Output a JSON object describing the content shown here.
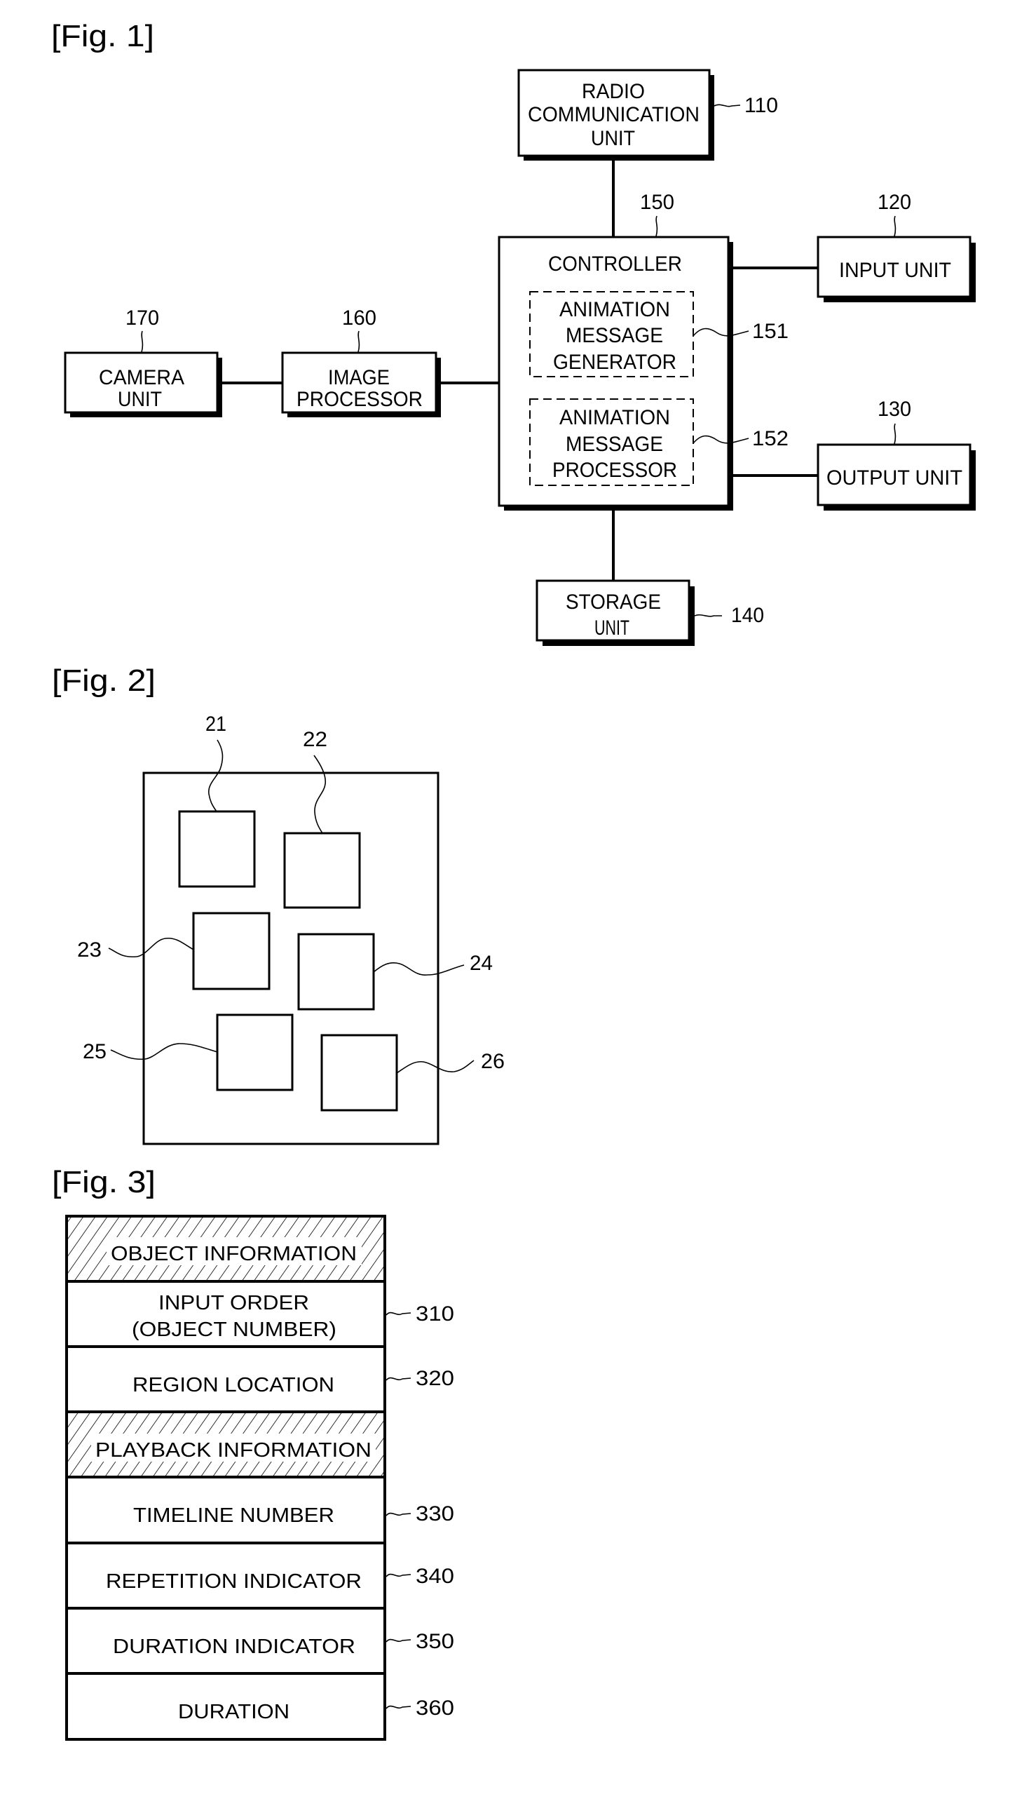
{
  "figures": {
    "fig1": {
      "title": "[Fig. 1]",
      "radio": {
        "line1": "RADIO",
        "line2": "COMMUNICATION",
        "line3": "UNIT",
        "ref": "110"
      },
      "input": {
        "label": "INPUT UNIT",
        "ref": "120"
      },
      "output": {
        "label": "OUTPUT UNIT",
        "ref": "130"
      },
      "storage": {
        "line1": "STORAGE",
        "line2": "UNIT",
        "ref": "140"
      },
      "controller": {
        "label": "CONTROLLER",
        "ref": "150"
      },
      "generator": {
        "line1": "ANIMATION",
        "line2": "MESSAGE",
        "line3": "GENERATOR",
        "ref": "151"
      },
      "processor": {
        "line1": "ANIMATION",
        "line2": "MESSAGE",
        "line3": "PROCESSOR",
        "ref": "152"
      },
      "image_processor": {
        "line1": "IMAGE",
        "line2": "PROCESSOR",
        "ref": "160"
      },
      "camera": {
        "line1": "CAMERA",
        "line2": "UNIT",
        "ref": "170"
      }
    },
    "fig2": {
      "title": "[Fig. 2]",
      "object_refs": [
        "21",
        "22",
        "23",
        "24",
        "25",
        "26"
      ]
    },
    "fig3": {
      "title": "[Fig. 3]",
      "rows": [
        {
          "label": "OBJECT INFORMATION",
          "ref": "",
          "hatched": true
        },
        {
          "label": "INPUT ORDER",
          "label2": "(OBJECT NUMBER)",
          "ref": "310",
          "hatched": false
        },
        {
          "label": "REGION LOCATION",
          "ref": "320",
          "hatched": false
        },
        {
          "label": "PLAYBACK INFORMATION",
          "ref": "",
          "hatched": true
        },
        {
          "label": "TIMELINE NUMBER",
          "ref": "330",
          "hatched": false
        },
        {
          "label": "REPETITION INDICATOR",
          "ref": "340",
          "hatched": false
        },
        {
          "label": "DURATION INDICATOR",
          "ref": "350",
          "hatched": false
        },
        {
          "label": "DURATION",
          "ref": "360",
          "hatched": false
        }
      ]
    }
  }
}
